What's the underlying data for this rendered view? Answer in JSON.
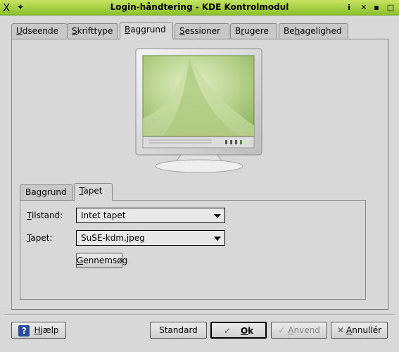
{
  "window": {
    "title": "Login-håndtering - KDE Kontrolmodul"
  },
  "tabs": [
    {
      "label": "Udseende",
      "accel": "U",
      "rest": "dseende"
    },
    {
      "label": "Skrifttype",
      "accel": "S",
      "rest": "krifttype"
    },
    {
      "label": "Baggrund",
      "accel": "B",
      "rest": "aggrund"
    },
    {
      "label": "Sessioner",
      "accel": "S",
      "rest": "essioner"
    },
    {
      "label": "Brugere",
      "accel": "r",
      "pre": "B",
      "rest": "ugere"
    },
    {
      "label": "Behagelighed",
      "pre": "Be",
      "accel": "h",
      "rest": "agelighed"
    }
  ],
  "inner_tabs": [
    {
      "label": "Baggrund"
    },
    {
      "label": "Tapet",
      "accel": "T",
      "rest": "apet"
    }
  ],
  "fields": {
    "state_label_accel": "T",
    "state_label_rest": "ilstand:",
    "state_value": "Intet tapet",
    "wallpaper_label_accel": "T",
    "wallpaper_label_rest": "apet:",
    "wallpaper_value": "SuSE-kdm.jpeg",
    "browse_accel": "G",
    "browse_rest": "ennemsøg"
  },
  "buttons": {
    "help_accel": "H",
    "help_rest": "jælp",
    "default": "Standard",
    "ok_accel": "O",
    "ok_rest": "k",
    "apply_accel": "A",
    "apply_rest": "nvend",
    "cancel_accel": "A",
    "cancel_rest": "nnullér"
  },
  "icons": [
    "kde-x-icon",
    "pin-icon",
    "info-icon",
    "close-x-icon",
    "minimize-icon",
    "maximize-icon",
    "help-question-icon",
    "check-icon",
    "cancel-x-icon"
  ]
}
